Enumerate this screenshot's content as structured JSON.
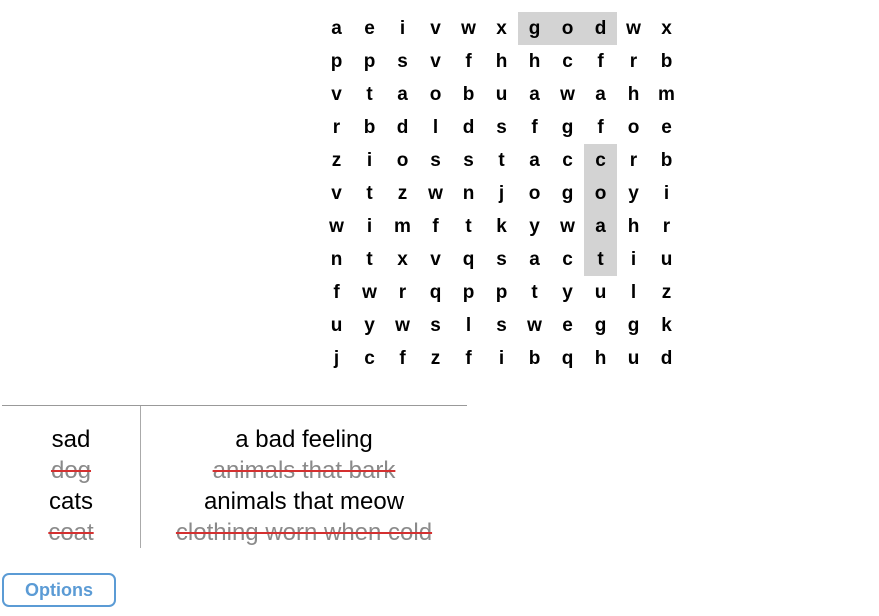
{
  "grid": {
    "rows": [
      [
        "a",
        "e",
        "i",
        "v",
        "w",
        "x",
        "g",
        "o",
        "d",
        "w",
        "x"
      ],
      [
        "p",
        "p",
        "s",
        "v",
        "f",
        "h",
        "h",
        "c",
        "f",
        "r",
        "b"
      ],
      [
        "v",
        "t",
        "a",
        "o",
        "b",
        "u",
        "a",
        "w",
        "a",
        "h",
        "m"
      ],
      [
        "r",
        "b",
        "d",
        "l",
        "d",
        "s",
        "f",
        "g",
        "f",
        "o",
        "e"
      ],
      [
        "z",
        "i",
        "o",
        "s",
        "s",
        "t",
        "a",
        "c",
        "c",
        "r",
        "b"
      ],
      [
        "v",
        "t",
        "z",
        "w",
        "n",
        "j",
        "o",
        "g",
        "o",
        "y",
        "i"
      ],
      [
        "w",
        "i",
        "m",
        "f",
        "t",
        "k",
        "y",
        "w",
        "a",
        "h",
        "r"
      ],
      [
        "n",
        "t",
        "x",
        "v",
        "q",
        "s",
        "a",
        "c",
        "t",
        "i",
        "u"
      ],
      [
        "f",
        "w",
        "r",
        "q",
        "p",
        "p",
        "t",
        "y",
        "u",
        "l",
        "z"
      ],
      [
        "u",
        "y",
        "w",
        "s",
        "l",
        "s",
        "w",
        "e",
        "g",
        "g",
        "k"
      ],
      [
        "j",
        "c",
        "f",
        "z",
        "f",
        "i",
        "b",
        "q",
        "h",
        "u",
        "d"
      ]
    ],
    "found_cells": [
      [
        0,
        6
      ],
      [
        0,
        7
      ],
      [
        0,
        8
      ],
      [
        4,
        8
      ],
      [
        5,
        8
      ],
      [
        6,
        8
      ],
      [
        7,
        8
      ]
    ],
    "highlight_color": "#d3d3d3"
  },
  "word_list": [
    {
      "word": "sad",
      "clue": "a bad feeling",
      "found": false
    },
    {
      "word": "dog",
      "clue": "animals that bark",
      "found": true
    },
    {
      "word": "cats",
      "clue": "animals that meow",
      "found": false
    },
    {
      "word": "coat",
      "clue": "clothing worn when cold",
      "found": true
    }
  ],
  "strike_color": "#d43030",
  "options_button": {
    "label": "Options",
    "color": "#5b9bd5"
  }
}
